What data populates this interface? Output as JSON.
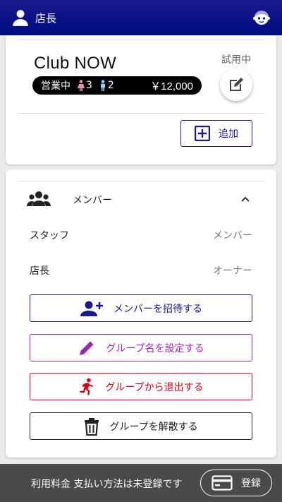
{
  "header": {
    "title": "店長",
    "user_icon": "user-icon",
    "profile_icon": "face-icon"
  },
  "club": {
    "name": "Club NOW",
    "trial_label": "試用中",
    "status": "営業中",
    "female_count": "3",
    "male_count": "2",
    "price": "￥12,000",
    "add_label": "追加",
    "colors": {
      "female": "#f48fb1",
      "male": "#90caf9"
    }
  },
  "members": {
    "header_label": "メンバー",
    "rows": [
      {
        "name": "スタッフ",
        "role": "メンバー"
      },
      {
        "name": "店長",
        "role": "オーナー"
      }
    ],
    "actions": {
      "invite": "メンバーを招待する",
      "rename": "グループ名を設定する",
      "leave": "グループから退出する",
      "dissolve": "グループを解散する"
    }
  },
  "footer": {
    "text": "利用料金 支払い方法は未登録です",
    "register_label": "登録"
  }
}
